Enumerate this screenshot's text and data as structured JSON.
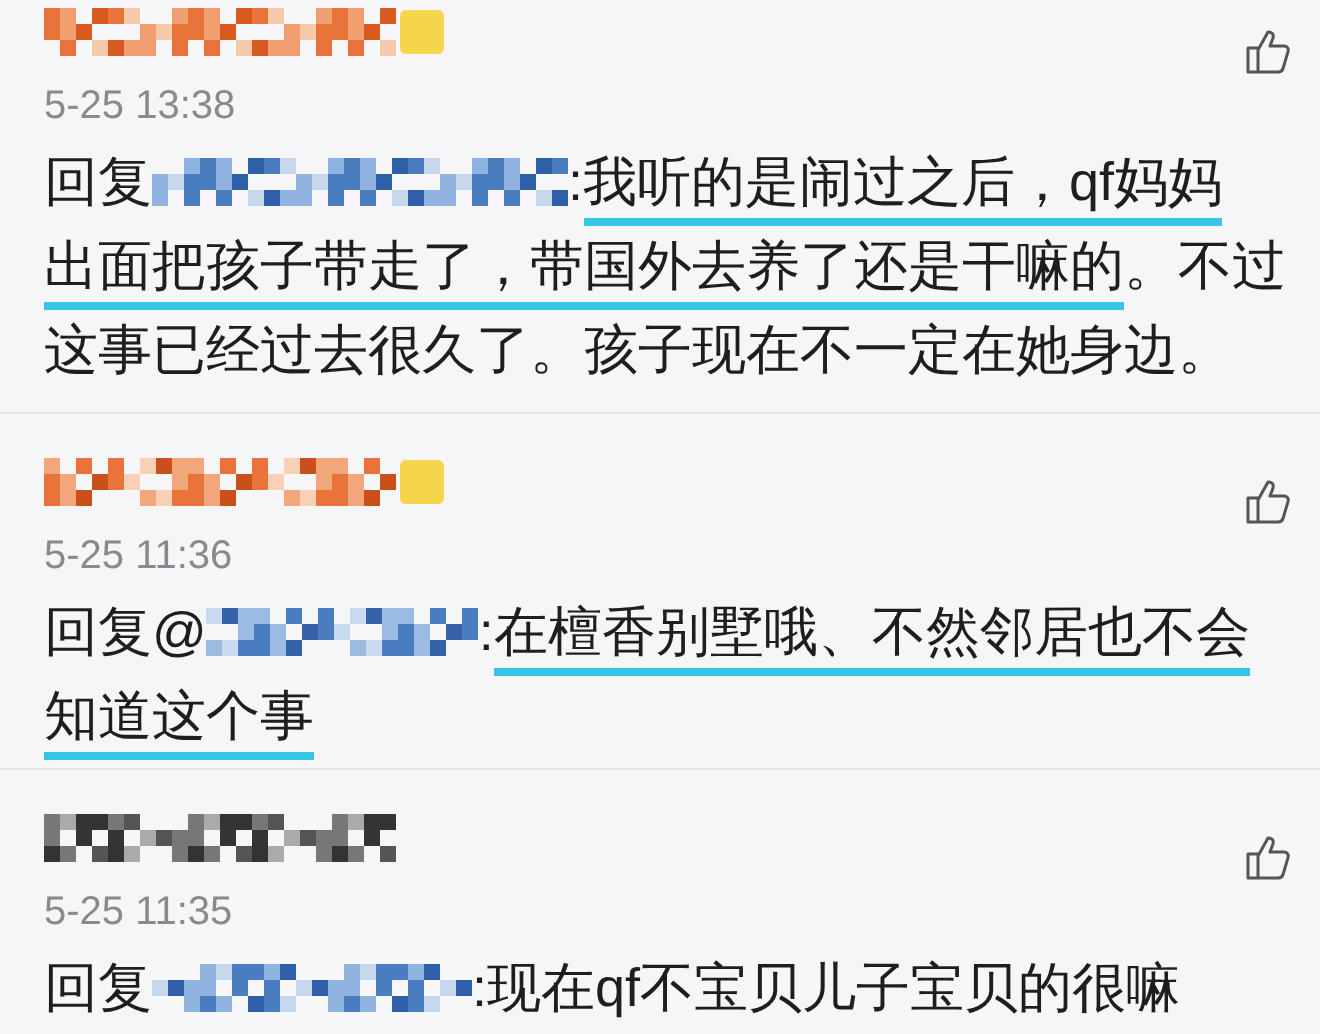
{
  "comments": [
    {
      "vip_badge": true,
      "time": "5-25 13:38",
      "reply_label": "回复",
      "lines": [
        {
          "segments": [
            {
              "text": ":",
              "underlined": false
            },
            {
              "text": "我听的是闹过之后，qf妈妈",
              "underlined": true
            }
          ]
        },
        {
          "segments": [
            {
              "text": "出面把孩子带走了，带国外去养了还是干嘛的",
              "underlined": true
            },
            {
              "text": "。不过",
              "underlined": false
            }
          ]
        },
        {
          "segments": [
            {
              "text": "这事已经过去很久了。孩子现在不一定在她身边。",
              "underlined": false
            }
          ]
        }
      ]
    },
    {
      "vip_badge": true,
      "time": "5-25 11:36",
      "reply_label": "回复@",
      "lines": [
        {
          "segments": [
            {
              "text": ":",
              "underlined": false
            },
            {
              "text": "在檀香别墅哦、不然邻居也不会",
              "underlined": true
            }
          ]
        },
        {
          "segments": [
            {
              "text": "知道这个事",
              "underlined": true
            }
          ]
        }
      ]
    },
    {
      "vip_badge": false,
      "time": "5-25 11:35",
      "reply_label": "回复",
      "lines": [
        {
          "segments": [
            {
              "text": ":现在qf不宝贝儿子宝贝的很嘛",
              "underlined": false
            }
          ]
        }
      ]
    }
  ]
}
